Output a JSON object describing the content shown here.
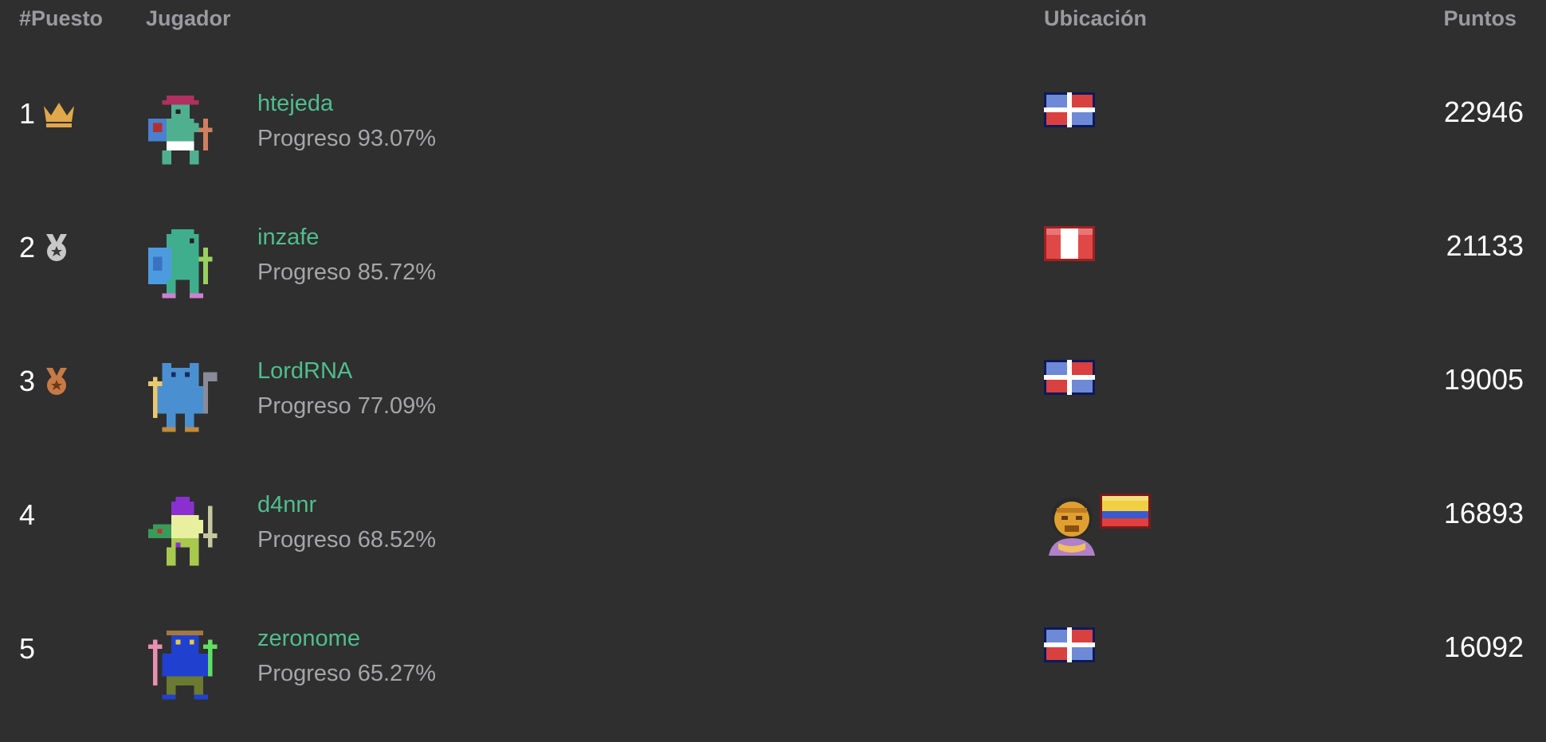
{
  "headers": {
    "rank": "#Puesto",
    "player": "Jugador",
    "location": "Ubicación",
    "points": "Puntos"
  },
  "players": [
    {
      "rank": "1",
      "badge": "crown-icon",
      "name": "htejeda",
      "progress": "Progreso 93.07%",
      "flags": [
        "dominican-republic-flag-icon"
      ],
      "points": "22946"
    },
    {
      "rank": "2",
      "badge": "silver-medal-icon",
      "name": "inzafe",
      "progress": "Progreso 85.72%",
      "flags": [
        "peru-flag-icon"
      ],
      "points": "21133"
    },
    {
      "rank": "3",
      "badge": "bronze-medal-icon",
      "name": "LordRNA",
      "progress": "Progreso 77.09%",
      "flags": [
        "dominican-republic-flag-icon"
      ],
      "points": "19005"
    },
    {
      "rank": "4",
      "badge": "",
      "name": "d4nnr",
      "progress": "Progreso 68.52%",
      "flags": [
        "golden-mask-icon",
        "colombia-flag-icon"
      ],
      "points": "16893"
    },
    {
      "rank": "5",
      "badge": "",
      "name": "zeronome",
      "progress": "Progreso 65.27%",
      "flags": [
        "dominican-republic-flag-icon"
      ],
      "points": "16092"
    }
  ],
  "colors": {
    "background": "#2f2f2f",
    "header": "#9a9aa0",
    "player_name": "#4fbe8e",
    "progress": "#a6a6aa",
    "text": "#ffffff",
    "gold": "#e0a84a",
    "silver": "#c8c8c8",
    "bronze": "#c77a46"
  }
}
